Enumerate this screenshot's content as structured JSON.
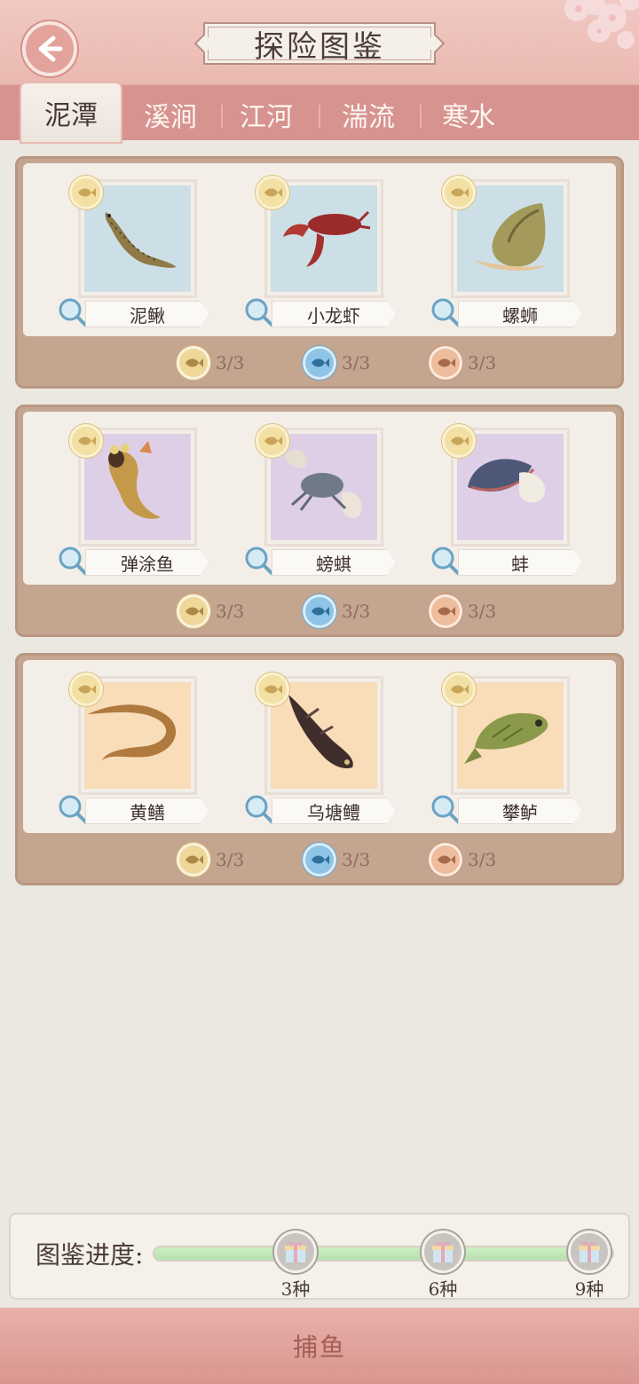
{
  "header": {
    "title": "探险图鉴"
  },
  "tabs": [
    {
      "label": "泥潭",
      "active": true
    },
    {
      "label": "溪涧",
      "active": false
    },
    {
      "label": "江河",
      "active": false
    },
    {
      "label": "湍流",
      "active": false
    },
    {
      "label": "寒水",
      "active": false
    }
  ],
  "groups": [
    {
      "rarity": "blue",
      "items": [
        {
          "name": "泥鳅",
          "icon": "loach-icon"
        },
        {
          "name": "小龙虾",
          "icon": "crayfish-icon"
        },
        {
          "name": "螺蛳",
          "icon": "snail-icon"
        }
      ],
      "stats": [
        {
          "tier": "gold",
          "value": "3/3"
        },
        {
          "tier": "blue",
          "value": "3/3"
        },
        {
          "tier": "copper",
          "value": "3/3"
        }
      ]
    },
    {
      "rarity": "purple",
      "items": [
        {
          "name": "弹涂鱼",
          "icon": "mudskipper-icon"
        },
        {
          "name": "螃蜞",
          "icon": "crab-icon"
        },
        {
          "name": "蚌",
          "icon": "clam-icon"
        }
      ],
      "stats": [
        {
          "tier": "gold",
          "value": "3/3"
        },
        {
          "tier": "blue",
          "value": "3/3"
        },
        {
          "tier": "copper",
          "value": "3/3"
        }
      ]
    },
    {
      "rarity": "peach",
      "items": [
        {
          "name": "黄鳝",
          "icon": "eel-icon"
        },
        {
          "name": "乌塘鳢",
          "icon": "sleeper-fish-icon"
        },
        {
          "name": "攀鲈",
          "icon": "perch-icon"
        }
      ],
      "stats": [
        {
          "tier": "gold",
          "value": "3/3"
        },
        {
          "tier": "blue",
          "value": "3/3"
        },
        {
          "tier": "copper",
          "value": "3/3"
        }
      ]
    }
  ],
  "progress": {
    "label": "图鉴进度:",
    "fraction": 1.0,
    "milestones": [
      {
        "label": "3种",
        "icon": "gift-box-icon"
      },
      {
        "label": "6种",
        "icon": "gift-box-icon"
      },
      {
        "label": "9种",
        "icon": "gift-box-icon"
      }
    ]
  },
  "bottom": {
    "label": "捕鱼"
  },
  "colors": {
    "header_pink": "#eab9b1",
    "tab_bar": "#d6938f",
    "card_frame": "#c4a58f",
    "progress_fill": "#b7e1ae"
  }
}
